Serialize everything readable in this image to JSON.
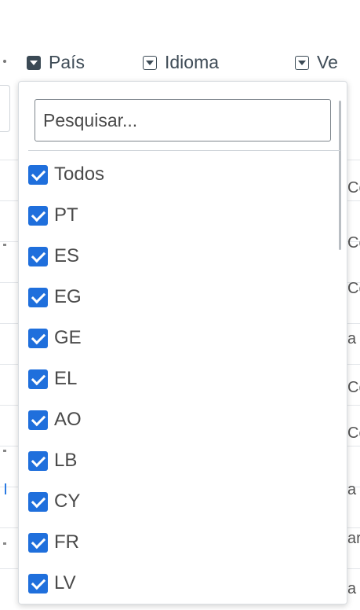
{
  "header": {
    "columns": [
      {
        "label": "País",
        "icon": "dropdown-filled-icon"
      },
      {
        "label": "Idioma",
        "icon": "dropdown-outline-icon"
      },
      {
        "label": "Ve",
        "icon": "dropdown-outline-icon"
      }
    ]
  },
  "background": {
    "right_cells": [
      "Cc",
      "Cc",
      "Cc",
      "a",
      "Cc",
      "Cc",
      "a",
      "ar",
      "a"
    ]
  },
  "filter": {
    "search_placeholder": "Pesquisar...",
    "options": [
      {
        "label": "Todos",
        "checked": true
      },
      {
        "label": "PT",
        "checked": true
      },
      {
        "label": "ES",
        "checked": true
      },
      {
        "label": "EG",
        "checked": true
      },
      {
        "label": "GE",
        "checked": true
      },
      {
        "label": "EL",
        "checked": true
      },
      {
        "label": "AO",
        "checked": true
      },
      {
        "label": "LB",
        "checked": true
      },
      {
        "label": "CY",
        "checked": true
      },
      {
        "label": "FR",
        "checked": true
      },
      {
        "label": "LV",
        "checked": true
      }
    ]
  },
  "colors": {
    "checkbox": "#1f6fdc",
    "header_text": "#3f4c57"
  }
}
